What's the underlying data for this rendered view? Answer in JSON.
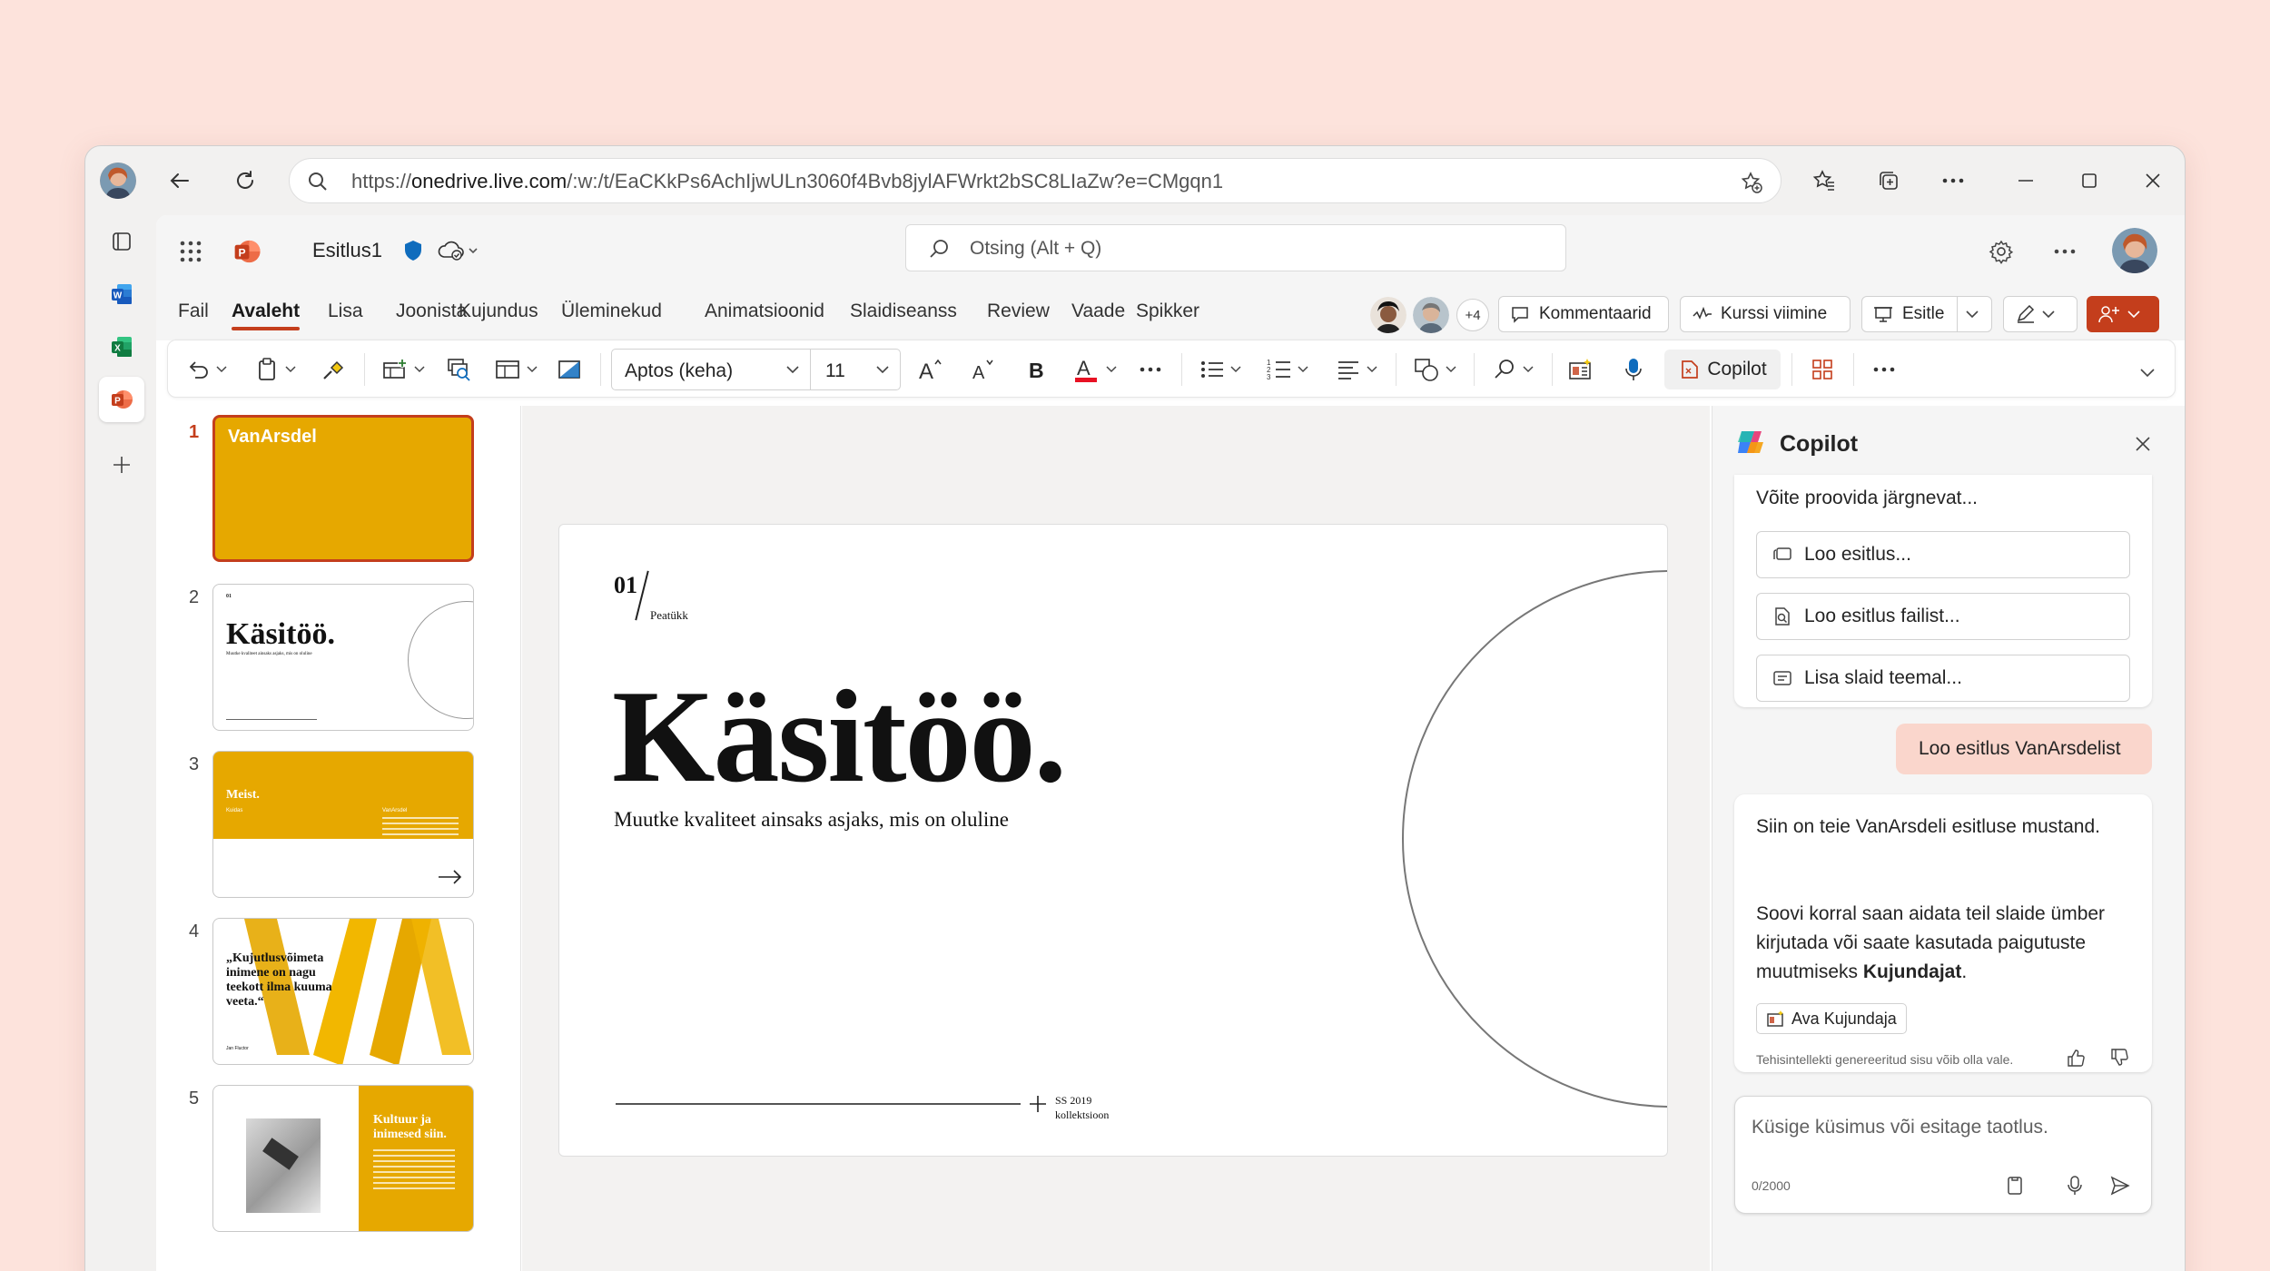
{
  "browser": {
    "url_prefix": "https://",
    "url_host": "onedrive.live.com",
    "url_path": "/:w:/t/EaCKkPs6AchIjwULn3060f4Bvb8jylAFWrkt2bSC8LIaZw?e=CMgqn1"
  },
  "app": {
    "doc_title": "Esitlus1",
    "search_placeholder": "Otsing (Alt + Q)",
    "menu": [
      "Fail",
      "Avaleht",
      "Lisa",
      "Joonista",
      "Kujundus",
      "Üleminekud",
      "Animatsioonid",
      "Slaidiseanss",
      "Review",
      "Vaade",
      "Spikker"
    ],
    "active_menu": "Avaleht",
    "collab_count": "+4",
    "comments_label": "Kommentaarid",
    "catchup_label": "Kurssi viimine",
    "present_label": "Esitle"
  },
  "ribbon": {
    "font_name": "Aptos (keha)",
    "font_size": "11",
    "copilot_label": "Copilot",
    "font_color": "#e81123"
  },
  "thumbnails": [
    {
      "number": "1",
      "logo": "VanArsdel"
    },
    {
      "number": "2",
      "title": "Käsitöö.",
      "subtitle": "Muutke kvaliteet ainsaks asjaks, mis on oluline"
    },
    {
      "number": "3",
      "title": "Meist.",
      "col_a": "Kuidas",
      "col_b": "VanArsdel"
    },
    {
      "number": "4",
      "quote": "„Kujutlusvõimeta inimene on nagu teekott ilma kuuma veeta.“",
      "author": "Jan Fluctor"
    },
    {
      "number": "5",
      "title": "Kultuur ja inimesed siin."
    }
  ],
  "slide": {
    "chapter_number": "01",
    "chapter_label": "Peatükk",
    "title": "Käsitöö.",
    "subtitle": "Muutke kvaliteet ainsaks asjaks, mis on oluline",
    "footer_line1": "SS 2019",
    "footer_line2": "kollektsioon"
  },
  "copilot": {
    "title": "Copilot",
    "suggest_heading": "Võite proovida järgnevat...",
    "suggestions": [
      "Loo esitlus...",
      "Loo esitlus failist...",
      "Lisa slaid teemal..."
    ],
    "user_message": "Loo esitlus VanArsdelist",
    "reply_p1": "Siin on teie VanArsdeli esitluse mustand.",
    "reply_p2_pre": "Soovi korral saan aidata teil slaide ümber kirjutada või saate kasutada paigutuste muutmiseks ",
    "reply_p2_bold": "Kujundajat",
    "reply_p2_post": ".",
    "designer_button": "Ava Kujundaja",
    "disclaimer": "Tehisintellekti genereeritud sisu võib olla vale.",
    "input_placeholder": "Küsige küsimus või esitage taotlus.",
    "char_count": "0/2000"
  },
  "colors": {
    "accent": "#c43e1c",
    "slide_yellow": "#e6a800",
    "user_bubble": "#fad6cc"
  }
}
